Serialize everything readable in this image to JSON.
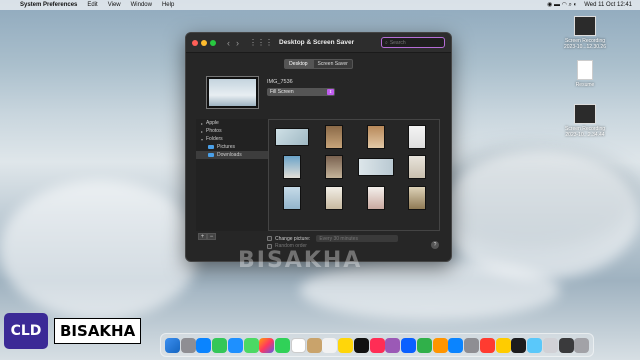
{
  "menubar": {
    "app_name": "System Preferences",
    "items": [
      "Edit",
      "View",
      "Window",
      "Help"
    ],
    "clock": "Wed 11 Oct  12:41"
  },
  "desktop_icons": [
    {
      "label": "Screen Recording 2023-10...12.30.26"
    },
    {
      "label": "Resume"
    },
    {
      "label": "Screen Recording 2023-10...2.34.44"
    }
  ],
  "window": {
    "title": "Desktop & Screen Saver",
    "search_placeholder": "Search",
    "tabs": [
      {
        "label": "Desktop",
        "active": true
      },
      {
        "label": "Screen Saver",
        "active": false
      }
    ],
    "current_image_name": "IMG_7536",
    "fill_mode": "Fill Screen",
    "sidebar": [
      {
        "label": "Apple",
        "type": "group",
        "expanded": false
      },
      {
        "label": "Photos",
        "type": "group",
        "expanded": false
      },
      {
        "label": "Folders",
        "type": "group",
        "expanded": true
      },
      {
        "label": "Pictures",
        "type": "folder"
      },
      {
        "label": "Downloads",
        "type": "folder",
        "selected": true
      }
    ],
    "change_picture_label": "Change picture:",
    "interval_value": "Every 30 minutes",
    "random_order_label": "Random order",
    "add_label": "+",
    "remove_label": "−",
    "help_label": "?"
  },
  "watermark": "BISAKHA",
  "branding": {
    "logo": "CLD",
    "name": "BISAKHA"
  },
  "colors": {
    "accent": "#b56cd6",
    "folder_blue": "#4aa0e8",
    "logo_bg": "#3b2a96"
  }
}
